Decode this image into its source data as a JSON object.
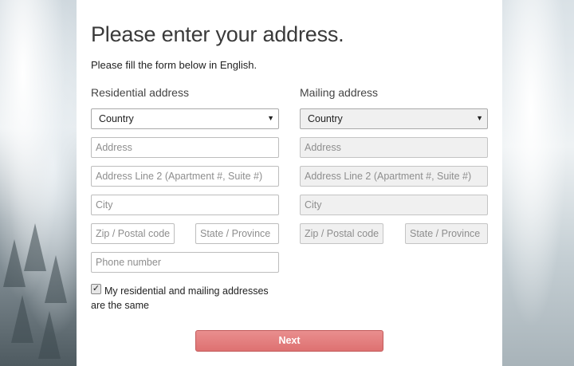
{
  "form": {
    "title": "Please enter your address.",
    "subtitle": "Please fill the form below in English.",
    "residential": {
      "heading": "Residential address",
      "country": "Country",
      "address_placeholder": "Address",
      "address2_placeholder": "Address Line 2 (Apartment #, Suite #)",
      "city_placeholder": "City",
      "zip_placeholder": "Zip / Postal code",
      "state_placeholder": "State / Province",
      "phone_placeholder": "Phone number"
    },
    "mailing": {
      "heading": "Mailing address",
      "country": "Country",
      "address_placeholder": "Address",
      "address2_placeholder": "Address Line 2 (Apartment #, Suite #)",
      "city_placeholder": "City",
      "zip_placeholder": "Zip / Postal code",
      "state_placeholder": "State / Province"
    },
    "same_address_label": "My residential and mailing addresses are the same",
    "same_address_checked": true,
    "check_mark": "✓",
    "dropdown_arrow": "▼",
    "next_label": "Next"
  },
  "colors": {
    "next_button": "#e07a7a",
    "disabled_field": "#f0f0f0"
  }
}
